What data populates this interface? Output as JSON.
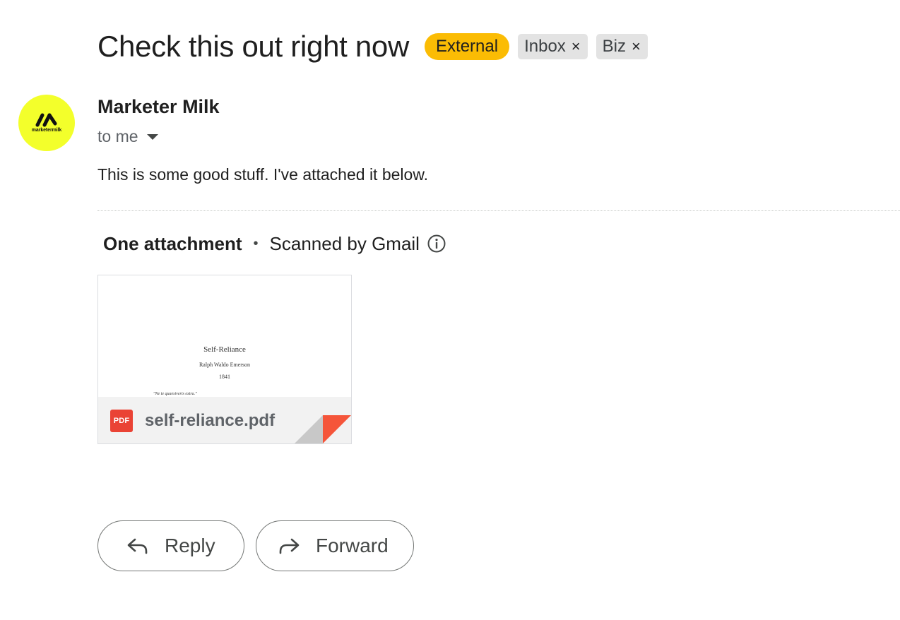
{
  "email": {
    "subject": "Check this out right now",
    "labels": {
      "external": "External",
      "chips": [
        {
          "name": "Inbox",
          "remove": "×"
        },
        {
          "name": "Biz",
          "remove": "×"
        }
      ]
    },
    "sender": {
      "name": "Marketer Milk",
      "avatar_text": "marketermilk",
      "avatar_color": "#f3ff2b"
    },
    "recipient": "to me",
    "body": "This is some good stuff. I've attached it below."
  },
  "attachments": {
    "count_label": "One attachment",
    "separator": "•",
    "scan_label": "Scanned by Gmail",
    "file": {
      "name": "self-reliance.pdf",
      "type_badge": "PDF",
      "badge_color": "#ea4335",
      "preview": {
        "title": "Self-Reliance",
        "author": "Ralph Waldo Emerson",
        "year": "1841",
        "quote": "\"Ne te quaesiveris extra.\""
      }
    }
  },
  "actions": {
    "reply": "Reply",
    "forward": "Forward"
  },
  "icons": {
    "info": "info-icon",
    "reply": "reply-arrow-icon",
    "forward": "forward-arrow-icon",
    "expand": "caret-down-icon"
  }
}
